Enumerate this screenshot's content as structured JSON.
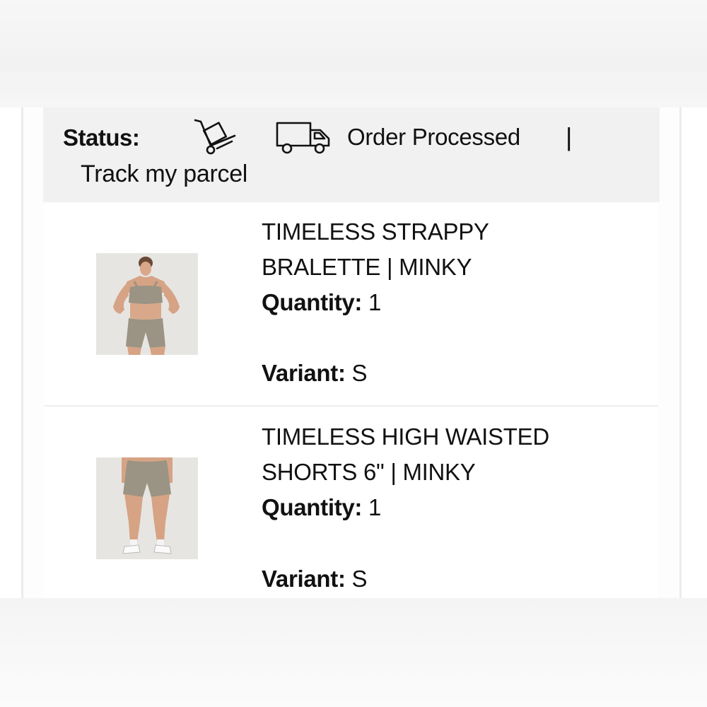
{
  "status": {
    "label": "Status:",
    "cart_icon": "cart-dolly-icon",
    "truck_icon": "delivery-truck-icon",
    "text": "Order Processed",
    "separator": "|",
    "track_link": "Track my parcel"
  },
  "items": [
    {
      "title_line1": "TIMELESS STRAPPY",
      "title_line2": "BRALETTE | MINKY",
      "quantity_label": "Quantity:",
      "quantity_value": "1",
      "variant_label": "Variant:",
      "variant_value": "S",
      "image_icon": "product-photo-bralette"
    },
    {
      "title_line1": "TIMELESS HIGH WAISTED",
      "title_line2": "SHORTS 6\" | MINKY",
      "quantity_label": "Quantity:",
      "quantity_value": "1",
      "variant_label": "Variant:",
      "variant_value": "S",
      "image_icon": "product-photo-shorts"
    }
  ],
  "colors": {
    "status_bg": "#f1f1f1",
    "product_color": "#9a9283",
    "text": "#111111"
  }
}
